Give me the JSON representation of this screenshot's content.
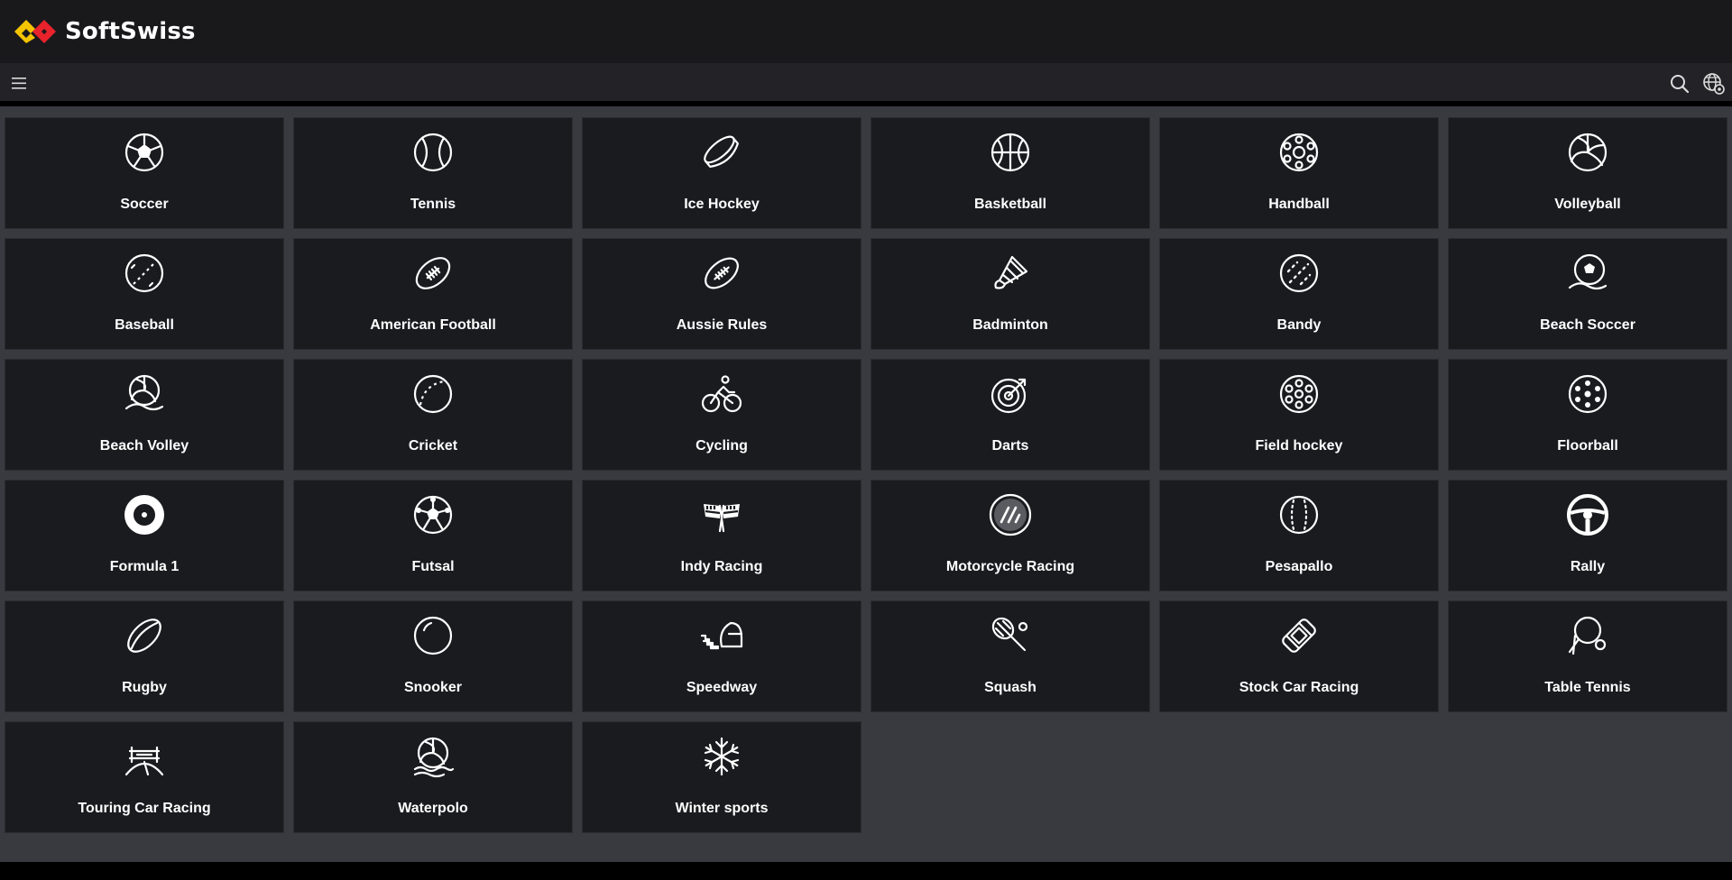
{
  "brand": {
    "name": "SoftSwiss",
    "logo_colors": [
      "#f5c400",
      "#e8232b"
    ]
  },
  "navbar": {
    "menu_icon": "hamburger-menu-icon",
    "search_icon": "search-icon",
    "language_icon": "globe-settings-icon"
  },
  "sports": [
    {
      "label": "Soccer",
      "icon": "soccer-ball-icon"
    },
    {
      "label": "Tennis",
      "icon": "tennis-ball-icon"
    },
    {
      "label": "Ice Hockey",
      "icon": "hockey-puck-icon"
    },
    {
      "label": "Basketball",
      "icon": "basketball-icon"
    },
    {
      "label": "Handball",
      "icon": "handball-icon"
    },
    {
      "label": "Volleyball",
      "icon": "volleyball-icon"
    },
    {
      "label": "Baseball",
      "icon": "baseball-icon"
    },
    {
      "label": "American Football",
      "icon": "american-football-icon"
    },
    {
      "label": "Aussie Rules",
      "icon": "aussie-rules-ball-icon"
    },
    {
      "label": "Badminton",
      "icon": "shuttlecock-icon"
    },
    {
      "label": "Bandy",
      "icon": "bandy-ball-icon"
    },
    {
      "label": "Beach Soccer",
      "icon": "beach-soccer-icon"
    },
    {
      "label": "Beach Volley",
      "icon": "beach-volley-icon"
    },
    {
      "label": "Cricket",
      "icon": "cricket-ball-icon"
    },
    {
      "label": "Cycling",
      "icon": "cycling-icon"
    },
    {
      "label": "Darts",
      "icon": "darts-target-icon"
    },
    {
      "label": "Field hockey",
      "icon": "field-hockey-ball-icon"
    },
    {
      "label": "Floorball",
      "icon": "floorball-icon"
    },
    {
      "label": "Formula 1",
      "icon": "formula-1-tire-icon"
    },
    {
      "label": "Futsal",
      "icon": "futsal-ball-icon"
    },
    {
      "label": "Indy Racing",
      "icon": "checkered-flags-icon"
    },
    {
      "label": "Motorcycle Racing",
      "icon": "motorcycle-racing-icon"
    },
    {
      "label": "Pesapallo",
      "icon": "pesapallo-ball-icon"
    },
    {
      "label": "Rally",
      "icon": "steering-wheel-icon"
    },
    {
      "label": "Rugby",
      "icon": "rugby-ball-icon"
    },
    {
      "label": "Snooker",
      "icon": "snooker-ball-icon"
    },
    {
      "label": "Speedway",
      "icon": "speedway-helmet-icon"
    },
    {
      "label": "Squash",
      "icon": "squash-racket-icon"
    },
    {
      "label": "Stock Car Racing",
      "icon": "stock-car-icon"
    },
    {
      "label": "Table Tennis",
      "icon": "table-tennis-paddle-icon"
    },
    {
      "label": "Touring Car Racing",
      "icon": "touring-car-icon"
    },
    {
      "label": "Waterpolo",
      "icon": "waterpolo-ball-icon"
    },
    {
      "label": "Winter sports",
      "icon": "snowflake-icon"
    }
  ]
}
